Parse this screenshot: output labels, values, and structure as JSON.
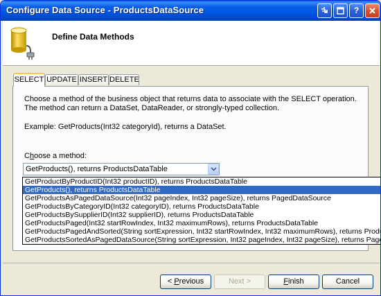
{
  "window": {
    "title": "Configure Data Source - ProductsDataSource"
  },
  "header": {
    "title": "Define Data Methods"
  },
  "tabs": [
    {
      "label": "SELECT"
    },
    {
      "label": "UPDATE"
    },
    {
      "label": "INSERT"
    },
    {
      "label": "DELETE"
    }
  ],
  "panel": {
    "description": "Choose a method of the business object that returns data to associate with the SELECT operation. The method can return a DataSet, DataReader, or strongly-typed collection.",
    "example": "Example: GetProducts(Int32 categoryId), returns a DataSet.",
    "choose_label_prefix": "C",
    "choose_label_accel": "h",
    "choose_label_rest": "oose a method:"
  },
  "method_select": {
    "selected_value": "GetProducts(), returns ProductsDataTable",
    "options": [
      "GetProductByProductID(Int32 productID), returns ProductsDataTable",
      "GetProducts(), returns ProductsDataTable",
      "GetProductsAsPagedDataSource(Int32 pageIndex, Int32 pageSize), returns PagedDataSource",
      "GetProductsByCategoryID(Int32 categoryID), returns ProductsDataTable",
      "GetProductsBySupplierID(Int32 supplierID), returns ProductsDataTable",
      "GetProductsPaged(Int32 startRowIndex, Int32 maximumRows), returns ProductsDataTable",
      "GetProductsPagedAndSorted(String sortExpression, Int32 startRowIndex, Int32 maximumRows), returns ProductsDataTable",
      "GetProductsSortedAsPagedDataSource(String sortExpression, Int32 pageIndex, Int32 pageSize), returns PagedDataSource"
    ],
    "highlighted_index": 1
  },
  "buttons": {
    "previous": {
      "pre": "< ",
      "accel": "P",
      "rest": "revious"
    },
    "next": {
      "text": "Next >"
    },
    "finish": {
      "accel": "F",
      "rest": "inish"
    },
    "cancel": {
      "text": "Cancel"
    }
  },
  "colors": {
    "titlebar": "#0054e3",
    "selection": "#316ac5",
    "tab_highlight": "#ffc73c"
  }
}
